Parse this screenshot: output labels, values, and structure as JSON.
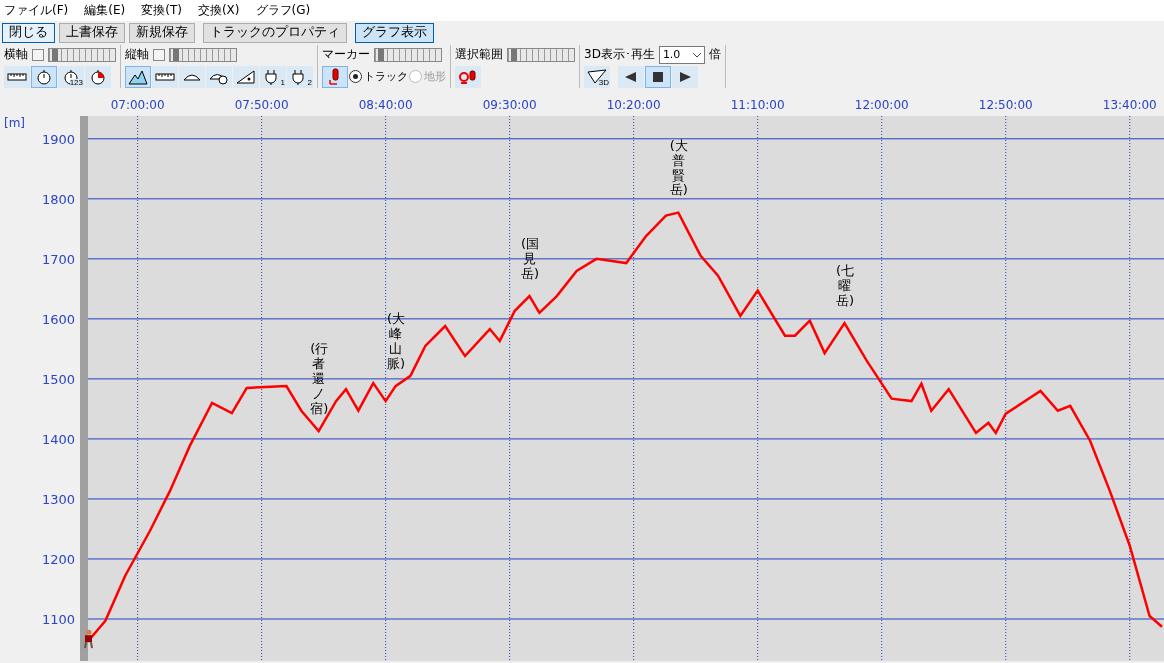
{
  "menu": [
    "ファイル(F)",
    "編集(E)",
    "変換(T)",
    "交換(X)",
    "グラフ(G)"
  ],
  "buttons": [
    {
      "label": "閉じる",
      "kind": "focused"
    },
    {
      "label": "上書保存",
      "kind": "plain"
    },
    {
      "label": "新規保存",
      "kind": "plain"
    },
    {
      "label": "トラックのプロパティ",
      "kind": "wide"
    },
    {
      "label": "グラフ表示",
      "kind": "pressed"
    }
  ],
  "toolbar": {
    "horizontal_axis": {
      "title": "横軸",
      "checked": false,
      "level": 0.05,
      "tools": [
        {
          "kind": "ruler",
          "selected": false
        },
        {
          "kind": "stopwatch",
          "selected": true
        },
        {
          "kind": "stopwatch",
          "badge": "123",
          "selected": false
        },
        {
          "kind": "timer",
          "selected": false
        }
      ]
    },
    "vertical_axis": {
      "title": "縦軸",
      "checked": false,
      "level": 0.05,
      "tools": [
        {
          "kind": "mountain",
          "selected": true
        },
        {
          "kind": "ruler",
          "selected": false
        },
        {
          "kind": "gauge",
          "selected": false
        },
        {
          "kind": "gaugeclock",
          "selected": false
        },
        {
          "kind": "slope",
          "selected": false
        },
        {
          "kind": "plug",
          "badge": "1",
          "selected": false
        },
        {
          "kind": "plug",
          "badge": "2",
          "selected": false
        }
      ]
    },
    "marker": {
      "title": "マーカー",
      "level": 0.05,
      "tool_selected": true,
      "options": [
        {
          "label": "トラック",
          "selected": true,
          "disabled": false
        },
        {
          "label": "地形",
          "selected": false,
          "disabled": true
        }
      ]
    },
    "selection_range": {
      "title": "選択範囲",
      "level": 0.05
    },
    "playback": {
      "title": "3D表示･再生",
      "speed": "1.0",
      "unit": "倍",
      "badge": "3D",
      "controls": [
        {
          "kind": "back",
          "selected": false
        },
        {
          "kind": "stop",
          "selected": true
        },
        {
          "kind": "play",
          "selected": false
        }
      ]
    }
  },
  "graph": {
    "unit": "[m]",
    "chart_data": {
      "type": "line",
      "grid": true,
      "xlim": [
        400,
        833
      ],
      "ylim": [
        1030,
        1938
      ],
      "xticks": [
        {
          "value": 420,
          "label": "07:00:00"
        },
        {
          "value": 470,
          "label": "07:50:00"
        },
        {
          "value": 520,
          "label": "08:40:00"
        },
        {
          "value": 570,
          "label": "09:30:00"
        },
        {
          "value": 620,
          "label": "10:20:00"
        },
        {
          "value": 670,
          "label": "11:10:00"
        },
        {
          "value": 720,
          "label": "12:00:00"
        },
        {
          "value": 770,
          "label": "12:50:00"
        },
        {
          "value": 820,
          "label": "13:40:00"
        }
      ],
      "yticks": [
        1100,
        1200,
        1300,
        1400,
        1500,
        1600,
        1700,
        1800,
        1900
      ],
      "x": [
        400,
        407,
        415,
        425,
        433,
        441,
        450,
        458,
        464,
        480,
        486,
        493,
        500,
        504,
        509,
        515,
        520,
        524,
        530,
        536,
        544,
        552,
        562,
        566,
        572,
        578,
        582,
        589,
        597,
        605,
        617,
        625,
        633,
        638,
        647,
        654,
        663,
        670,
        681,
        685,
        691,
        697,
        705,
        714,
        724,
        732,
        736,
        740,
        747,
        758,
        763,
        766,
        770,
        784,
        791,
        796,
        804,
        812,
        820,
        828,
        833
      ],
      "series": [
        {
          "color": "#ff0000",
          "values": [
            1063,
            1097,
            1172,
            1247,
            1313,
            1388,
            1460,
            1443,
            1485,
            1488,
            1447,
            1413,
            1463,
            1483,
            1447,
            1493,
            1463,
            1488,
            1505,
            1555,
            1588,
            1538,
            1583,
            1563,
            1613,
            1638,
            1610,
            1638,
            1680,
            1700,
            1693,
            1738,
            1772,
            1777,
            1705,
            1672,
            1605,
            1647,
            1572,
            1572,
            1597,
            1543,
            1593,
            1530,
            1467,
            1463,
            1492,
            1447,
            1483,
            1410,
            1427,
            1410,
            1442,
            1480,
            1447,
            1455,
            1397,
            1313,
            1222,
            1105,
            1087
          ]
        }
      ],
      "annotations": [
        "(行者還ノ宿)",
        "(大峰山脈)",
        "(国見岳)",
        "(大普賢岳)",
        "(七曜岳)"
      ]
    }
  }
}
